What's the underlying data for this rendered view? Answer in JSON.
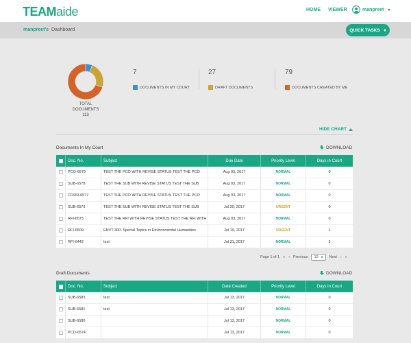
{
  "header": {
    "logo_bold": "TEAM",
    "logo_thin": "aide",
    "nav": [
      "HOME",
      "VIEWER"
    ],
    "user_name": "manpreet"
  },
  "subbar": {
    "user_crumb": "manpreet's",
    "page": "Dashboard",
    "quick_tasks": "QUICK TASKS"
  },
  "summary": {
    "total_label_1": "TOTAL",
    "total_label_2": "DOCUMENTS",
    "total": "113",
    "court_count": "7",
    "court_label": "DOCUMENTS IN MY COURT",
    "court_color": "#3b8fd4",
    "draft_count": "27",
    "draft_label": "DRAFT DOCUMENTS",
    "draft_color": "#c9a43b",
    "created_count": "79",
    "created_label": "DOCUMENTS CREATED BY ME",
    "created_color": "#d4622b",
    "hide_chart": "HIDE CHART"
  },
  "chart_data": {
    "type": "pie",
    "categories": [
      "DOCUMENTS IN MY COURT",
      "DRAFT DOCUMENTS",
      "DOCUMENTS CREATED BY ME"
    ],
    "values": [
      7,
      27,
      79
    ]
  },
  "court": {
    "title": "Documents In My Court",
    "download": "DOWNLOAD",
    "headers": [
      "Doc. No.",
      "Subject",
      "Due Date",
      "Priority Level",
      "Days in Court"
    ],
    "rows": [
      {
        "doc": "PCO-6579",
        "subject": "TEST THE PCO WITH REVISE STATUS TEST THE PCO",
        "date": "Aug 03, 2017",
        "priority": "NORMAL",
        "days": "0"
      },
      {
        "doc": "SUB-6578",
        "subject": "TEST THE SUB WITH REVISE STATUS TEST THE SUB",
        "date": "Aug 03, 2017",
        "priority": "NORMAL",
        "days": "0"
      },
      {
        "doc": "CORR-6577",
        "subject": "TEST THE PCO WITH REVISE STATUS TEST THE PCO",
        "date": "Aug 03, 2017",
        "priority": "NORMAL",
        "days": "0"
      },
      {
        "doc": "SUB-6576",
        "subject": "TEST THE SUB WITH REVISE STATUS TEST THE SUB",
        "date": "Jul 20, 2017",
        "priority": "URGENT",
        "days": "0"
      },
      {
        "doc": "RFI-6575",
        "subject": "TEST THE RFI WITH REVISE STATUS TEST THE RFI WITH",
        "date": "Aug 03, 2017",
        "priority": "NORMAL",
        "days": "0"
      },
      {
        "doc": "RFI-6509",
        "subject": "ENVT 300. Special Topics in Environmental Humanities",
        "date": "Jul 19, 2017",
        "priority": "URGENT",
        "days": "1"
      },
      {
        "doc": "RFI-6442",
        "subject": "test",
        "date": "Jul 31, 2017",
        "priority": "NORMAL",
        "days": "3"
      }
    ]
  },
  "pager": {
    "page_info": "Page 1 of 1",
    "first": "«",
    "prev": "‹",
    "previous_label": "Previous",
    "per_page": "10",
    "next_label": "Next",
    "next": "›",
    "last": "»"
  },
  "drafts": {
    "title": "Draft Documents",
    "download": "DOWNLOAD",
    "headers": [
      "Doc. No.",
      "Subject",
      "Date Created",
      "Priority Level",
      "Days in Court"
    ],
    "rows": [
      {
        "doc": "SUB-6583",
        "subject": "test",
        "date": "Jul 13, 2017",
        "priority": "NORMAL",
        "days": "0"
      },
      {
        "doc": "SUB-6581",
        "subject": "test",
        "date": "Jul 13, 2017",
        "priority": "NORMAL",
        "days": "0"
      },
      {
        "doc": "SUB-6580",
        "subject": "",
        "date": "Jul 13, 2017",
        "priority": "NORMAL",
        "days": "0"
      },
      {
        "doc": "PCO-6574",
        "subject": "",
        "date": "Jul 13, 2017",
        "priority": "NORMAL",
        "days": "0"
      }
    ]
  }
}
